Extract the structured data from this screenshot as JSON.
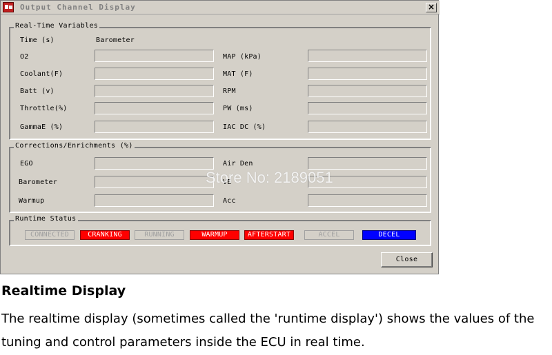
{
  "window": {
    "title": "Output Channel Display",
    "close_glyph": "×"
  },
  "realtime": {
    "legend": "Real-Time Variables",
    "time_label": "Time (s)",
    "barometer_label": "Barometer",
    "left": [
      {
        "label": "O2",
        "value": ""
      },
      {
        "label": "Coolant(F)",
        "value": ""
      },
      {
        "label": "Batt (v)",
        "value": ""
      },
      {
        "label": "Throttle(%)",
        "value": ""
      },
      {
        "label": "GammaE (%)",
        "value": ""
      }
    ],
    "right": [
      {
        "label": "MAP (kPa)",
        "value": ""
      },
      {
        "label": "MAT (F)",
        "value": ""
      },
      {
        "label": "RPM",
        "value": ""
      },
      {
        "label": "PW (ms)",
        "value": ""
      },
      {
        "label": "IAC DC (%)",
        "value": ""
      }
    ]
  },
  "corrections": {
    "legend": "Corrections/Enrichments (%)",
    "left": [
      {
        "label": "EGO",
        "value": ""
      },
      {
        "label": "Barometer",
        "value": ""
      },
      {
        "label": "Warmup",
        "value": ""
      }
    ],
    "right": [
      {
        "label": "Air Den",
        "value": ""
      },
      {
        "label": "VE",
        "value": ""
      },
      {
        "label": "Acc",
        "value": ""
      }
    ]
  },
  "runtime_status": {
    "legend": "Runtime Status",
    "indicators": [
      {
        "label": "CONNECTED",
        "color": "#d4d0c8"
      },
      {
        "label": "CRANKING",
        "color": "#ff0000"
      },
      {
        "label": "RUNNING",
        "color": "#d4d0c8"
      },
      {
        "label": "WARMUP",
        "color": "#ff0000"
      },
      {
        "label": "AFTERSTART",
        "color": "#ff0000"
      },
      {
        "label": "ACCEL",
        "color": "#d4d0c8"
      },
      {
        "label": "DECEL",
        "color": "#0000ff"
      }
    ]
  },
  "buttons": {
    "close_label": "Close"
  },
  "watermark": "Store No: 2189051",
  "caption": {
    "heading": "Realtime Display",
    "body": "The realtime display (sometimes called the 'runtime display') shows the values of the tuning and control parameters inside the ECU in real time."
  }
}
